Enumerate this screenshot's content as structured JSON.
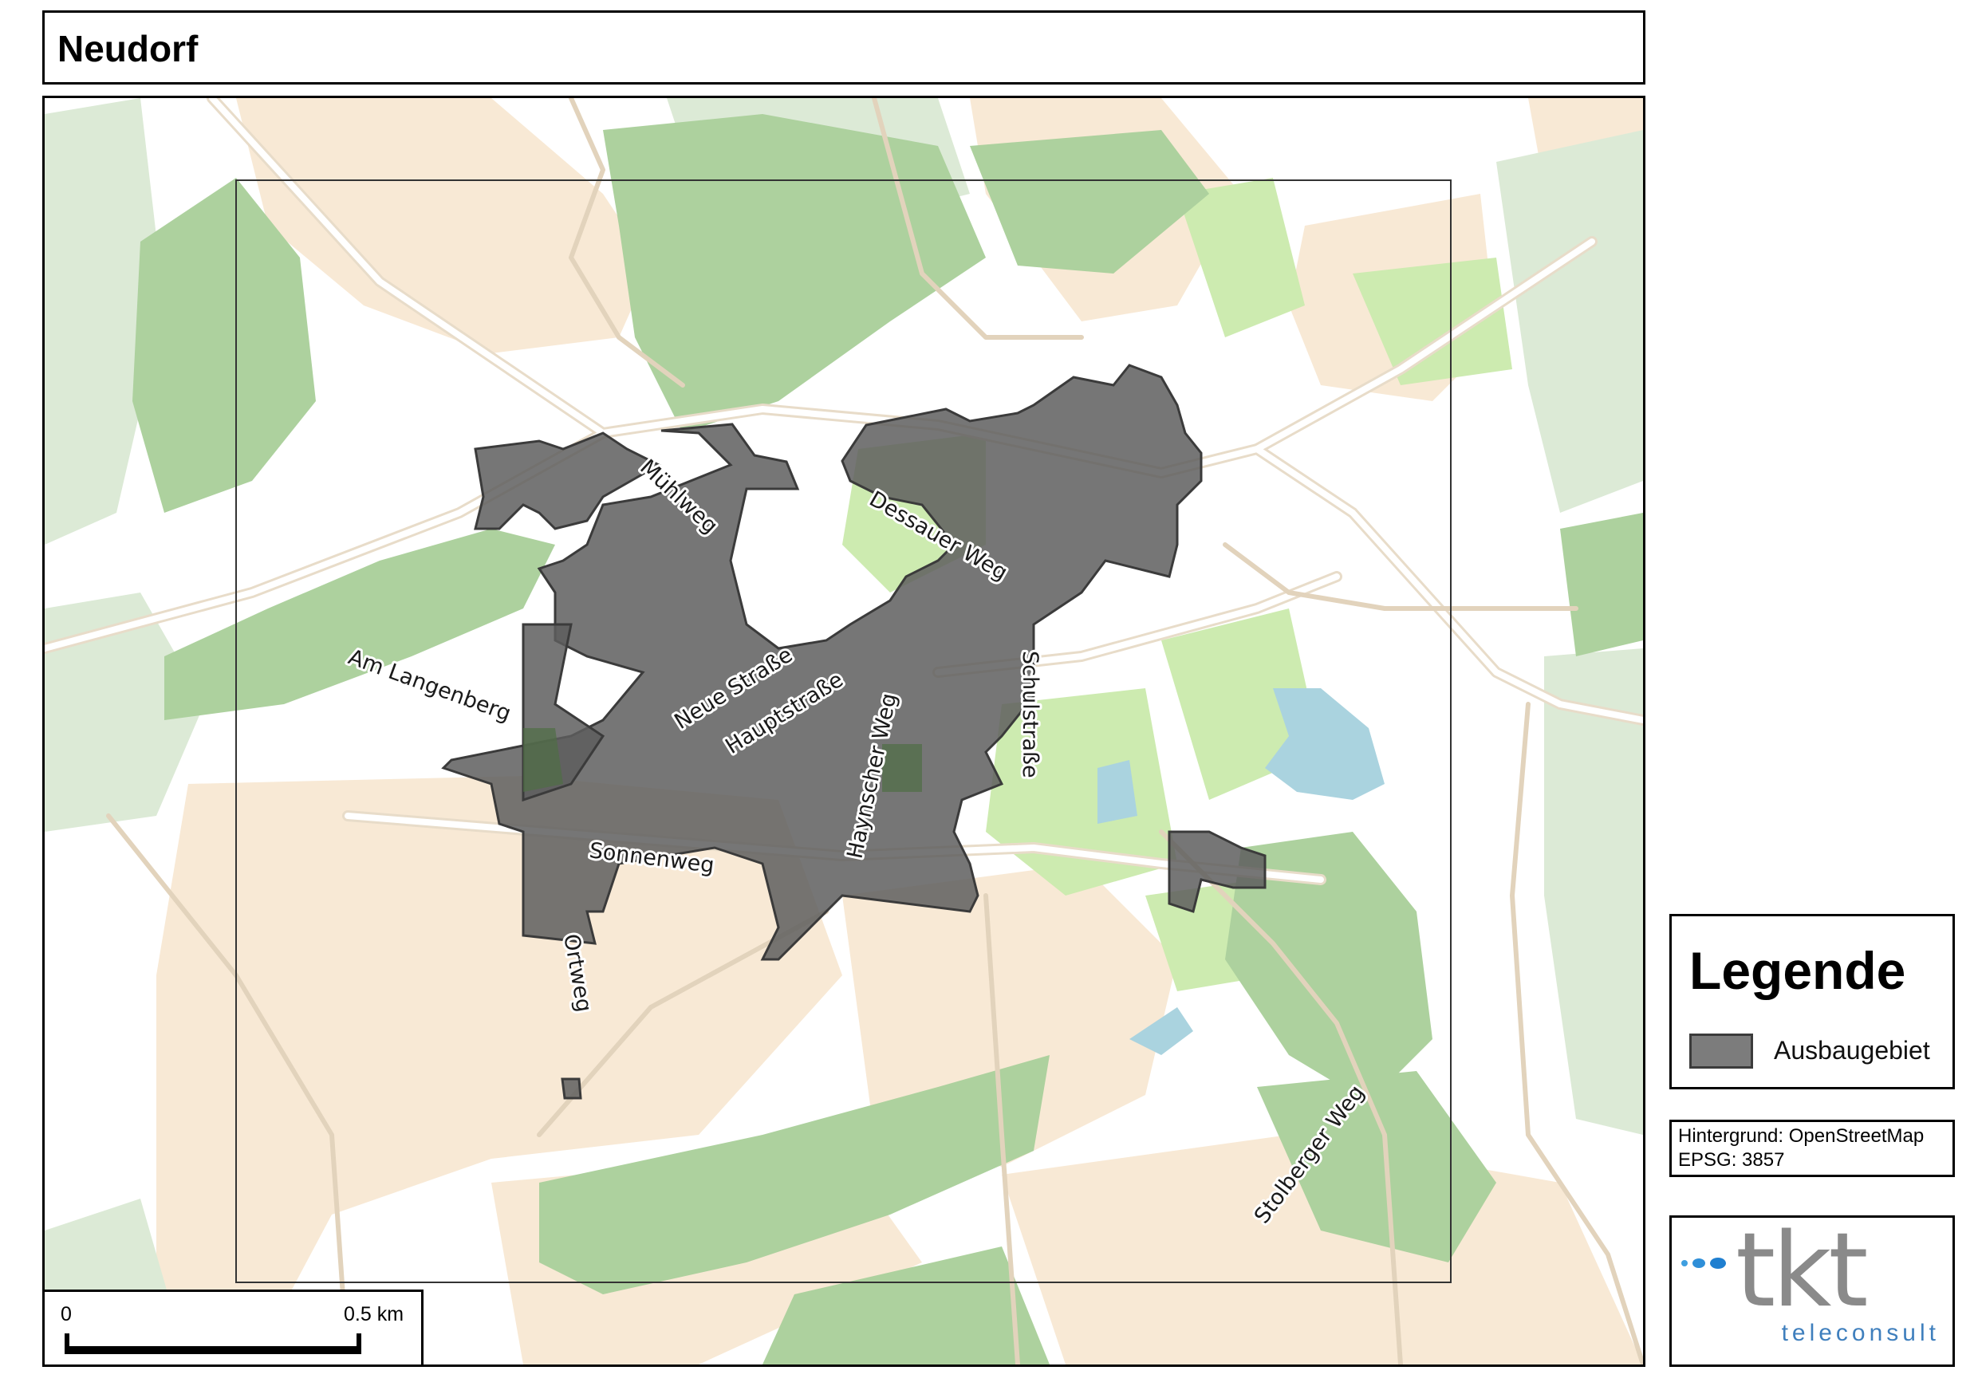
{
  "title": "Neudorf",
  "streets": [
    {
      "name": "Mühlweg"
    },
    {
      "name": "Dessauer Weg"
    },
    {
      "name": "Am Langenberg"
    },
    {
      "name": "Neue Straße"
    },
    {
      "name": "Hauptstraße"
    },
    {
      "name": "Haynscher Weg"
    },
    {
      "name": "Schulstraße"
    },
    {
      "name": "Sonnenweg"
    },
    {
      "name": "Ortweg"
    },
    {
      "name": "Stolberger Weg"
    }
  ],
  "scale": {
    "start_label": "0",
    "end_label": "0.5 km"
  },
  "legend": {
    "heading": "Legende",
    "items": [
      {
        "label": "Ausbaugebiet",
        "color": "#7c7c7c"
      }
    ]
  },
  "info": {
    "background": "Hintergrund: OpenStreetMap",
    "crs": "EPSG: 3857"
  },
  "logo": {
    "wordmark": "tkt",
    "tagline": "teleconsult"
  },
  "colors": {
    "forest": "#add19e",
    "meadow": "#cdebb0",
    "farmland": "#f8e9d5",
    "woodland_light": "#dcead6",
    "water": "#aad3df",
    "road": "#f3ece2",
    "area": "#5e5e5e"
  }
}
